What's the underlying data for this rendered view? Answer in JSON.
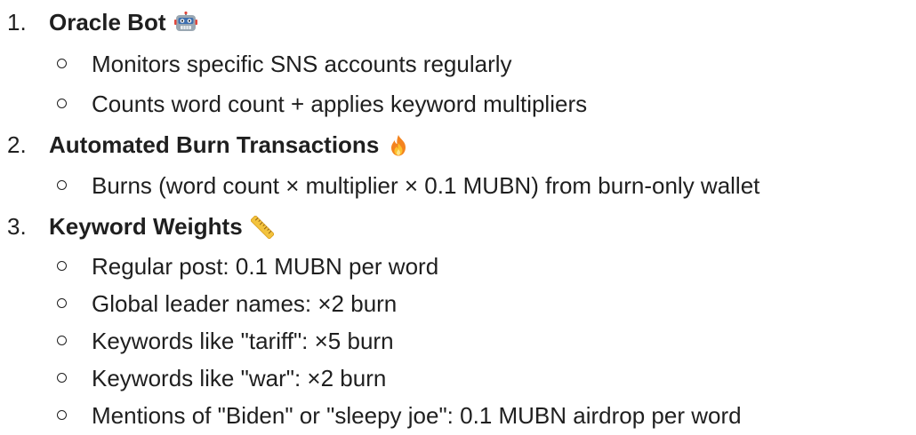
{
  "list": [
    {
      "number": "1.",
      "title": "Oracle Bot",
      "icon": "robot-icon",
      "items": [
        "Monitors specific SNS accounts regularly",
        "Counts word count + applies keyword multipliers"
      ]
    },
    {
      "number": "2.",
      "title": "Automated Burn Transactions",
      "icon": "fire-icon",
      "items": [
        "Burns (word count × multiplier × 0.1 MUBN) from burn-only wallet"
      ]
    },
    {
      "number": "3.",
      "title": "Keyword Weights",
      "icon": "ruler-icon",
      "items": [
        "Regular post: 0.1 MUBN per word",
        "Global leader names: ×2 burn",
        "Keywords like \"tariff\": ×5 burn",
        "Keywords like \"war\": ×2 burn",
        "Mentions of \"Biden\" or \"sleepy joe\": 0.1 MUBN airdrop per word"
      ]
    }
  ]
}
